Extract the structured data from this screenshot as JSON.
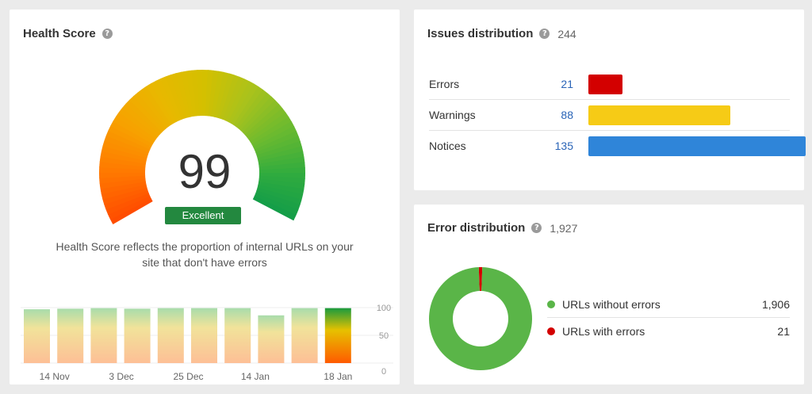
{
  "health_score": {
    "title": "Health Score",
    "help_icon": "question-icon",
    "score": "99",
    "badge": "Excellent",
    "description_line1": "Health Score reflects the proportion of internal URLs on your",
    "description_line2": "site that don't have errors",
    "gauge_value_percent": 99,
    "chart_data": {
      "type": "bar",
      "categories": [
        "",
        "14 Nov",
        "",
        "3 Dec",
        "",
        "25 Dec",
        "",
        "14 Jan",
        "",
        "18 Jan"
      ],
      "x_tick_labels": [
        "14 Nov",
        "3 Dec",
        "25 Dec",
        "14 Jan",
        "18 Jan"
      ],
      "values": [
        97,
        98,
        99,
        98,
        99,
        99,
        99,
        86,
        99,
        99
      ],
      "highlighted_index": 9,
      "y_tick_labels": [
        "100",
        "50",
        "0"
      ],
      "ylim": [
        0,
        100
      ],
      "grid": true
    }
  },
  "issues_distribution": {
    "title": "Issues distribution",
    "help_icon": "question-icon",
    "total": "244",
    "chart_data": {
      "type": "bar",
      "categories": [
        "Errors",
        "Warnings",
        "Notices"
      ],
      "values": [
        21,
        88,
        135
      ],
      "colors": [
        "#d30000",
        "#f6cb16",
        "#2f85d9"
      ]
    },
    "rows": [
      {
        "label": "Errors",
        "count": "21"
      },
      {
        "label": "Warnings",
        "count": "88"
      },
      {
        "label": "Notices",
        "count": "135"
      }
    ]
  },
  "error_distribution": {
    "title": "Error distribution",
    "help_icon": "question-icon",
    "total": "1,927",
    "chart_data": {
      "type": "pie",
      "categories": [
        "URLs without errors",
        "URLs with errors"
      ],
      "values": [
        1906,
        21
      ],
      "colors": [
        "#5ab548",
        "#d30000"
      ]
    },
    "legend": [
      {
        "label": "URLs without errors",
        "value": "1,906",
        "color": "#5ab548"
      },
      {
        "label": "URLs with errors",
        "value": "21",
        "color": "#d30000"
      }
    ]
  }
}
